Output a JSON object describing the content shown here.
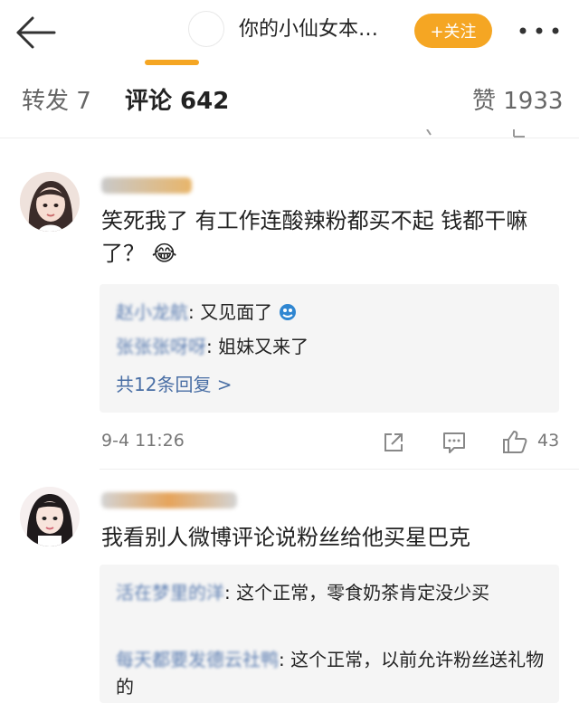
{
  "header": {
    "title": "你的小仙女本…",
    "follow_label": "+关注"
  },
  "tabs": {
    "forward": "转发 7",
    "comments": "评论 642",
    "likes": "赞 1933"
  },
  "comments": [
    {
      "text": "笑死我了 有工作连酸辣粉都买不起 钱都干嘛了？",
      "emoji": "😂",
      "replies": [
        {
          "name": "赵小龙航",
          "text": ": 又见面了"
        },
        {
          "name": "张张张呀呀",
          "text": ": 姐妹又来了"
        }
      ],
      "more_replies": "共12条回复 >",
      "time": "9-4 11:26",
      "likes": "43"
    },
    {
      "text": "我看别人微博评论说粉丝给他买星巴克",
      "replies": [
        {
          "name": "活在梦里的洋",
          "text": ": 这个正常，零食奶茶肯定没少买"
        },
        {
          "name": "每天都要发德云社鸭",
          "text": ": 这个正常，以前允许粉丝送礼物的"
        }
      ]
    }
  ],
  "colors": {
    "accent": "#f5a623",
    "link": "#4a6fa5"
  }
}
